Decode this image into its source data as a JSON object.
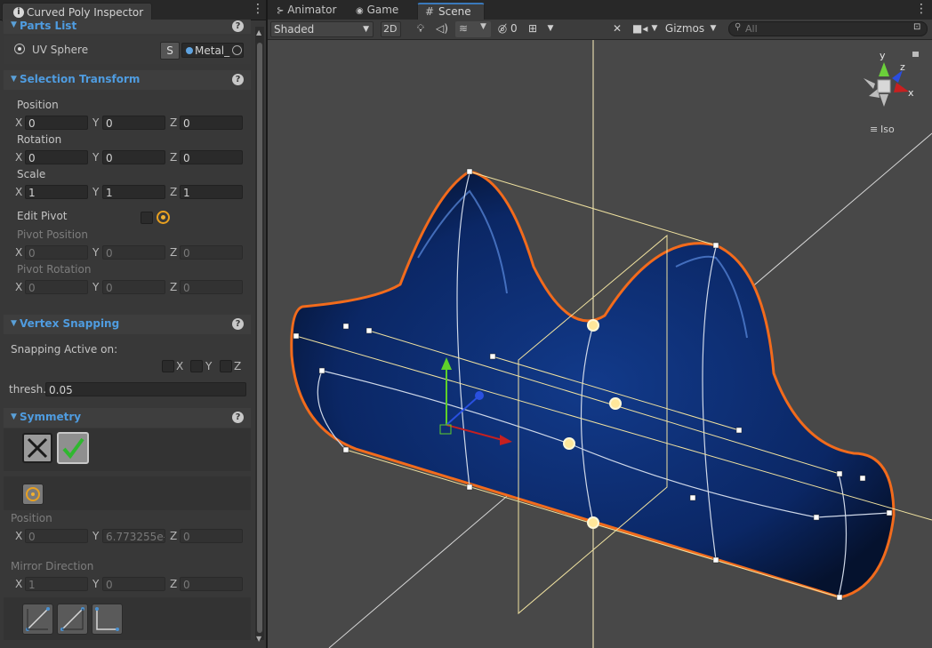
{
  "inspector": {
    "tab_title": "Curved Poly Inspector",
    "parts_list": {
      "title": "Parts List",
      "item": "UV Sphere",
      "s_button": "S",
      "material": "Metal_"
    },
    "selection_transform": {
      "title": "Selection Transform",
      "position_label": "Position",
      "position": {
        "x": "0",
        "y": "0",
        "z": "0"
      },
      "rotation_label": "Rotation",
      "rotation": {
        "x": "0",
        "y": "0",
        "z": "0"
      },
      "scale_label": "Scale",
      "scale": {
        "x": "1",
        "y": "1",
        "z": "1"
      },
      "edit_pivot_label": "Edit Pivot",
      "pivot_position_label": "Pivot Position",
      "pivot_position": {
        "x": "0",
        "y": "0",
        "z": "0"
      },
      "pivot_rotation_label": "Pivot Rotation",
      "pivot_rotation": {
        "x": "0",
        "y": "0",
        "z": "0"
      }
    },
    "vertex_snapping": {
      "title": "Vertex Snapping",
      "active_label": "Snapping Active on:",
      "axes": [
        "X",
        "Y",
        "Z"
      ],
      "thresh_label": "thresh.",
      "thresh_value": "0.05"
    },
    "symmetry": {
      "title": "Symmetry",
      "position_label": "Position",
      "position": {
        "x": "0",
        "y": "6.773255e-",
        "z": "0"
      },
      "mirror_label": "Mirror Direction",
      "mirror": {
        "x": "1",
        "y": "0",
        "z": "0"
      }
    },
    "axis_labels": {
      "x": "X",
      "y": "Y",
      "z": "Z"
    }
  },
  "scene_view": {
    "tabs": [
      "Animator",
      "Game",
      "Scene"
    ],
    "shading_mode": "Shaded",
    "mode_2d": "2D",
    "hidden_count": "0",
    "gizmos_label": "Gizmos",
    "search_placeholder": "All",
    "projection_label": "Iso",
    "gizmo_axes": {
      "x": "x",
      "y": "y",
      "z": "z"
    }
  },
  "colors": {
    "accent_blue": "#4f9ce0",
    "selection_orange": "#f07020",
    "mesh_blue": "#0b2a6e",
    "handle_yellow": "#ffe79a"
  }
}
